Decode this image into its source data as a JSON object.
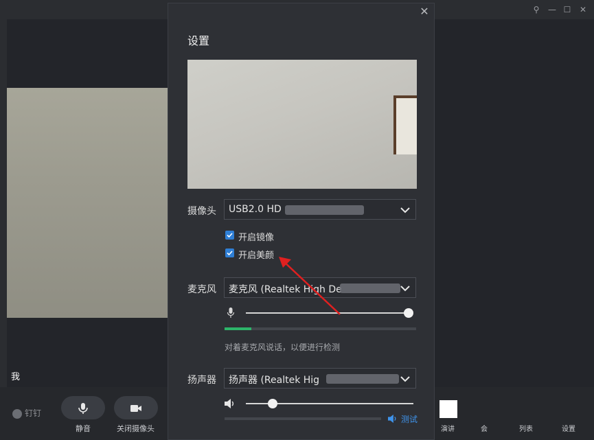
{
  "window_controls": {
    "pin_icon": "pin-icon",
    "minimize_icon": "minimize-icon",
    "maximize_icon": "maximize-icon",
    "close_icon": "close-icon"
  },
  "self_view": {
    "name": "我"
  },
  "bottom_bar": {
    "brand": "钉钉",
    "mute_label": "静音",
    "camera_off_label": "关闭摄像头",
    "right_labels": [
      "演讲",
      "会",
      "列表",
      "设置"
    ]
  },
  "settings": {
    "title": "设置",
    "camera": {
      "label": "摄像头",
      "value": "USB2.0 HD"
    },
    "mirror": {
      "label": "开启镜像",
      "checked": true
    },
    "beauty": {
      "label": "开启美颜",
      "checked": true
    },
    "microphone": {
      "label": "麦克风",
      "value": "麦克风 (Realtek High De",
      "volume": 1.0,
      "input_level": 0.14
    },
    "mic_hint": "对着麦克风说话，以便进行检测",
    "speaker": {
      "label": "扬声器",
      "value": "扬声器 (Realtek Hig",
      "volume": 0.15,
      "test_label": "测试"
    },
    "accent_color": "#2f7fd6",
    "annotation_arrow_color": "#e02020"
  }
}
